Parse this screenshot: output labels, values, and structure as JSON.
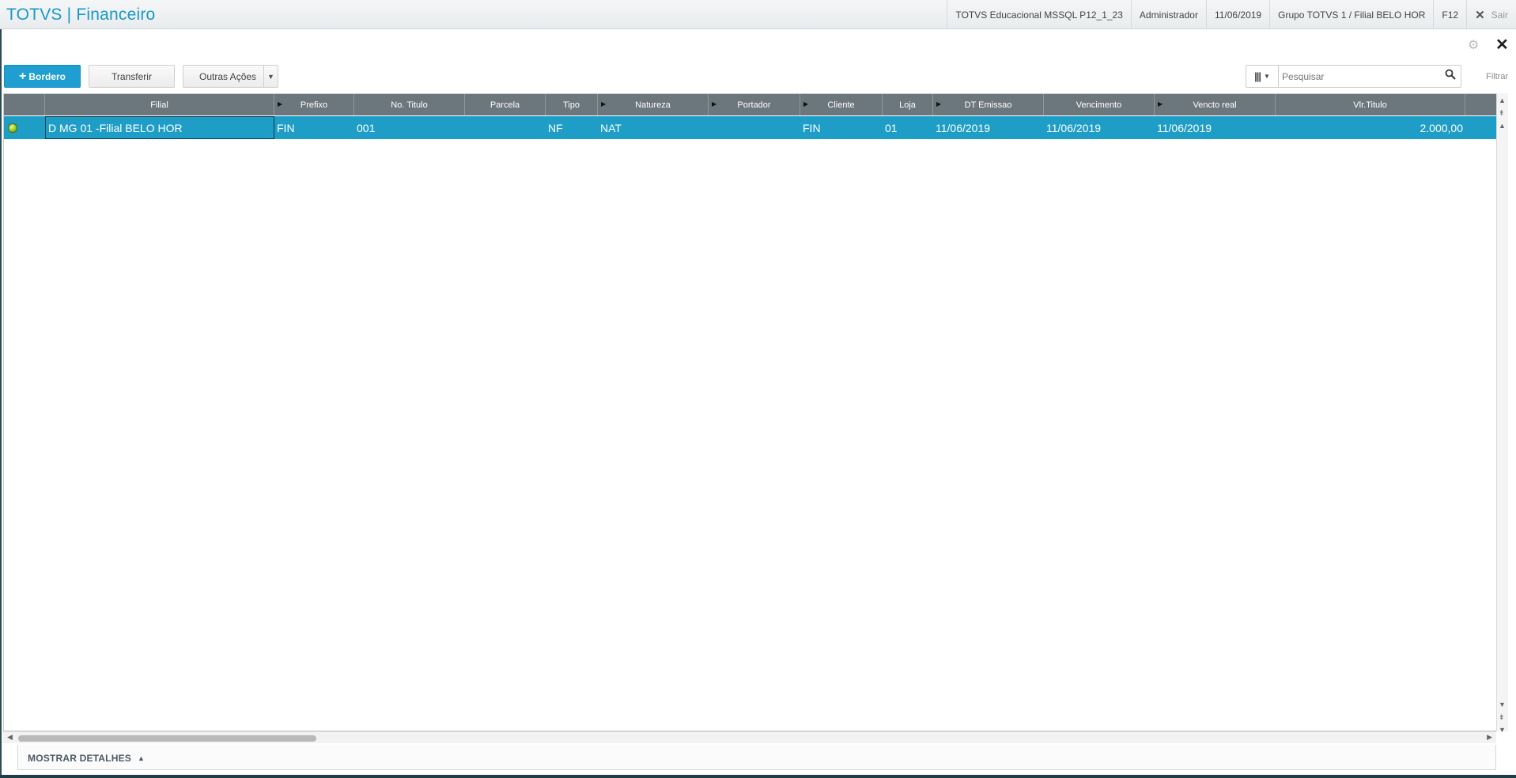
{
  "header": {
    "title": "TOTVS | Financeiro",
    "environment": "TOTVS Educacional MSSQL P12_1_23",
    "user": "Administrador",
    "date": "11/06/2019",
    "branch": "Grupo TOTVS 1 / Filial BELO HOR",
    "shortcut": "F12",
    "exit_label": "Sair"
  },
  "toolbar": {
    "bordero_label": "Bordero",
    "transferir_label": "Transferir",
    "outras_label": "Outras Ações"
  },
  "search": {
    "placeholder": "Pesquisar",
    "filter_label": "Filtrar"
  },
  "grid": {
    "columns": [
      "Filial",
      "Prefixo",
      "No. Titulo",
      "Parcela",
      "Tipo",
      "Natureza",
      "Portador",
      "Cliente",
      "Loja",
      "DT Emissao",
      "Vencimento",
      "Vencto real",
      "Vlr.Titulo"
    ],
    "rows": [
      {
        "status": "green",
        "filial": "D MG 01 -Filial BELO HOR",
        "prefixo": "FIN",
        "no_titulo": "001",
        "parcela": "",
        "tipo": "NF",
        "natureza": "NAT",
        "portador": "",
        "cliente": "FIN",
        "loja": "01",
        "dt_emissao": "11/06/2019",
        "vencimento": "11/06/2019",
        "vencto_real": "11/06/2019",
        "vlr_titulo": "2.000,00"
      }
    ]
  },
  "footer": {
    "details_label": "MOSTRAR DETALHES"
  },
  "colors": {
    "accent": "#1e9ed1",
    "header_bg": "#6c777d",
    "selected_row": "#1e9dc6",
    "status_ok": "#8fc41e"
  }
}
